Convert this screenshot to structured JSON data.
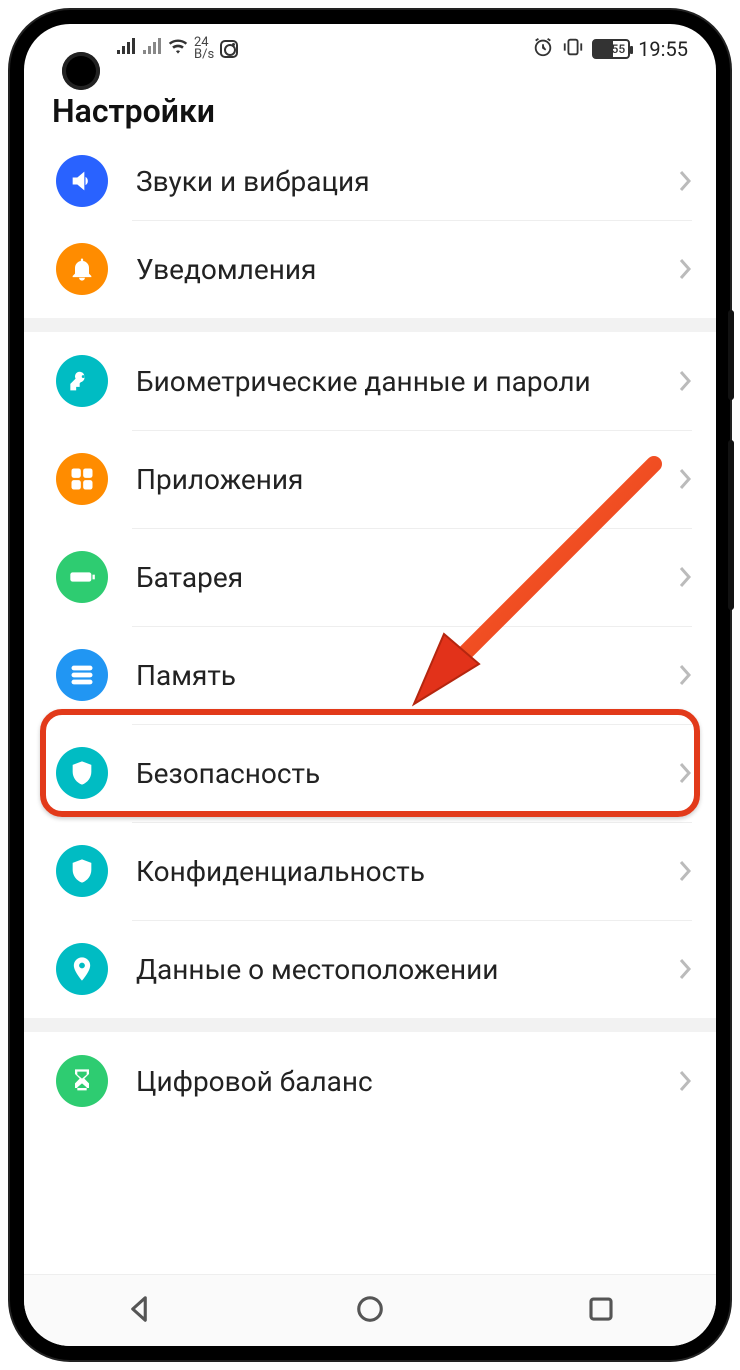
{
  "status": {
    "speed_num": "24",
    "speed_unit": "B/s",
    "battery_pct": "55",
    "time": "19:55"
  },
  "page_title": "Настройки",
  "items": [
    {
      "label": "Звуки и вибрация",
      "icon": "speaker",
      "color": "c-blue"
    },
    {
      "label": "Уведомления",
      "icon": "bell",
      "color": "c-orange"
    },
    {
      "label": "Биометрические данные и пароли",
      "icon": "key",
      "color": "c-teal"
    },
    {
      "label": "Приложения",
      "icon": "apps",
      "color": "c-orange2"
    },
    {
      "label": "Батарея",
      "icon": "battery",
      "color": "c-green"
    },
    {
      "label": "Память",
      "icon": "storage",
      "color": "c-blue2"
    },
    {
      "label": "Безопасность",
      "icon": "shield",
      "color": "c-teal"
    },
    {
      "label": "Конфиденциальность",
      "icon": "privacy",
      "color": "c-teal"
    },
    {
      "label": "Данные о местоположении",
      "icon": "location",
      "color": "c-teal"
    },
    {
      "label": "Цифровой баланс",
      "icon": "hourglass",
      "color": "c-green"
    }
  ],
  "highlighted_index": 6
}
